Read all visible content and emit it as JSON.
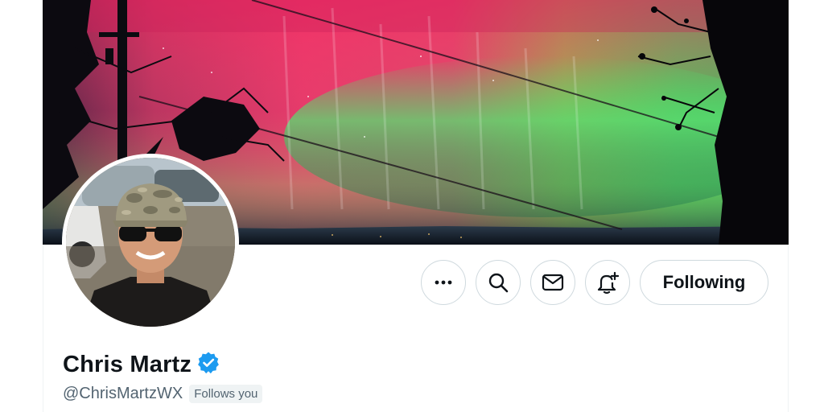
{
  "profile": {
    "display_name": "Chris Martz",
    "handle": "@ChrisMartzWX",
    "follows_you_label": "Follows you",
    "verified": true
  },
  "actions": {
    "more_icon": "more-horizontal-icon",
    "search_icon": "search-icon",
    "message_icon": "mail-icon",
    "notify_icon": "bell-plus-icon",
    "following_label": "Following"
  },
  "colors": {
    "verified_badge": "#1d9bf0",
    "text_primary": "#0f1419",
    "text_secondary": "#536471",
    "border": "#cfd9de"
  }
}
